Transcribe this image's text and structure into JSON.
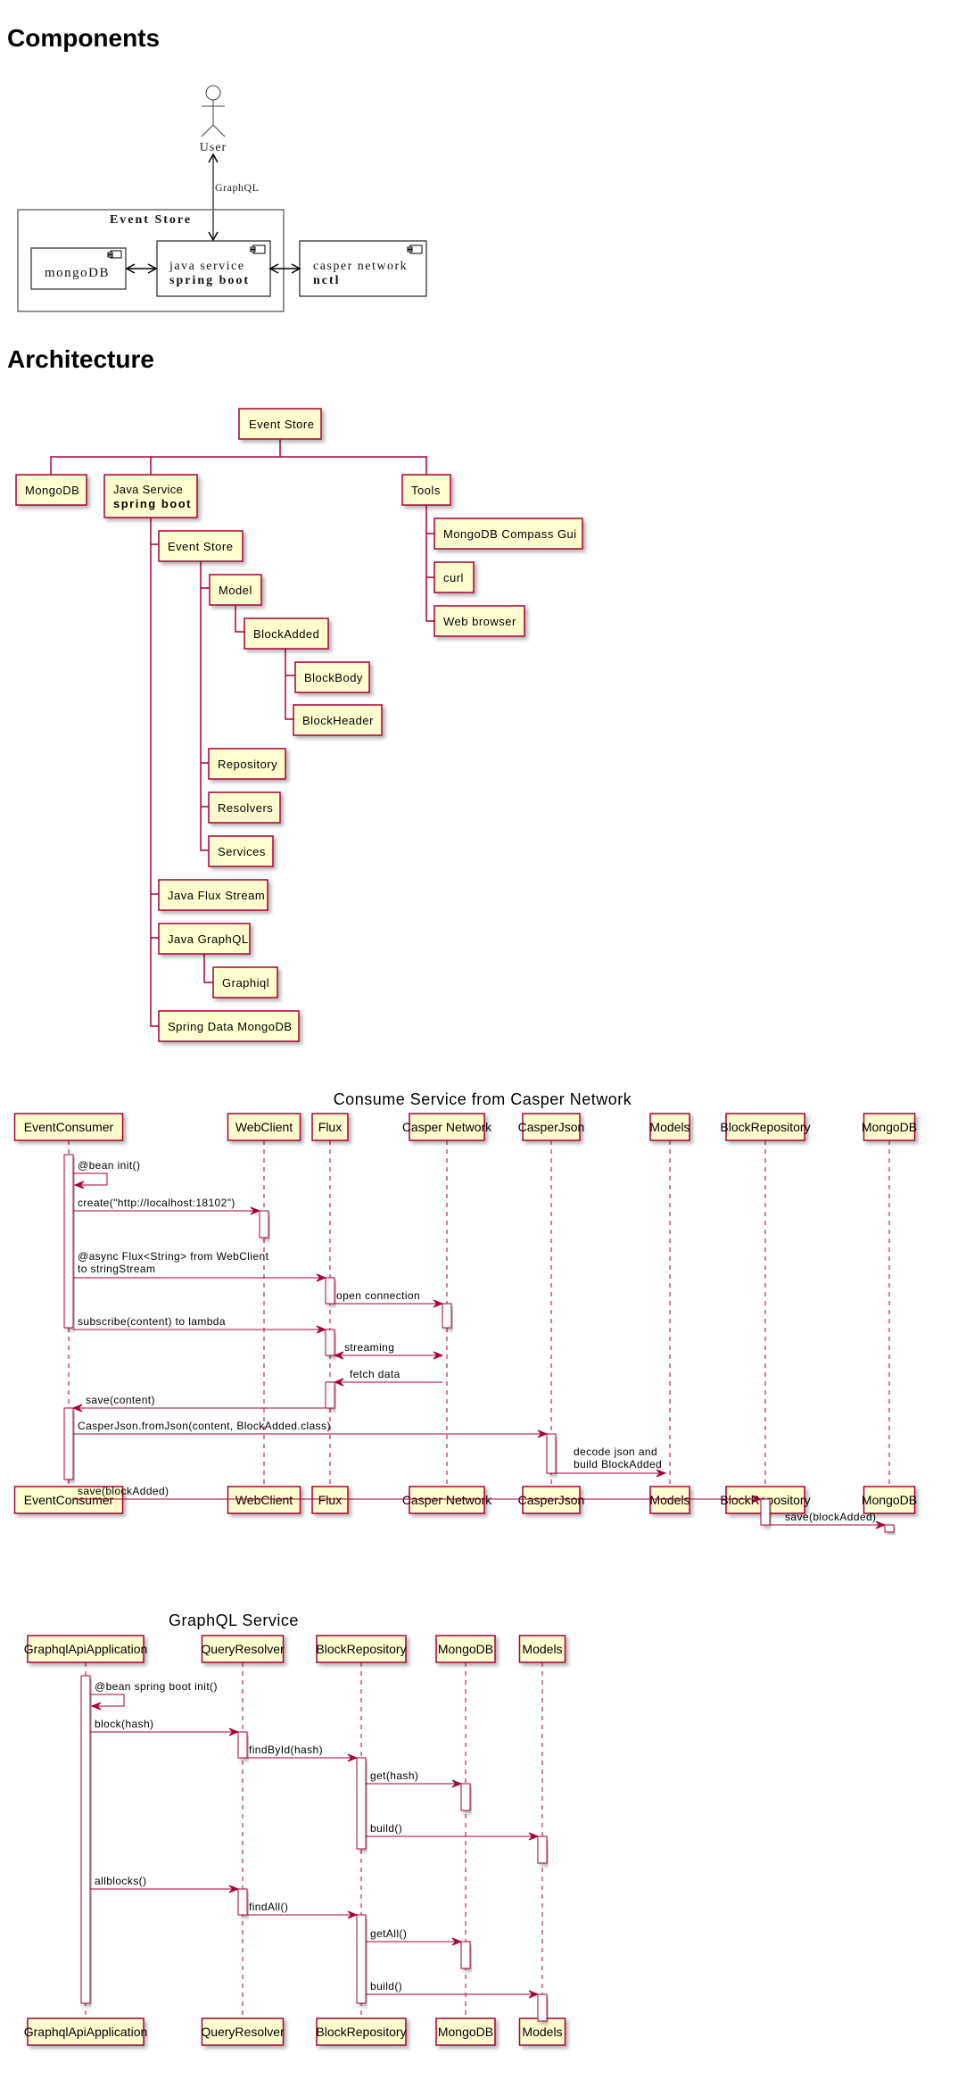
{
  "sections": {
    "components_title": "Components",
    "architecture_title": "Architecture"
  },
  "components": {
    "actor": {
      "label": "User",
      "icon": "actor-stick-figure-icon"
    },
    "link_label": "GraphQL",
    "package": {
      "title": "Event Store"
    },
    "nodes": {
      "mongodb": {
        "label": "mongoDB",
        "icon": "component-icon"
      },
      "java_service": {
        "line1": "java service",
        "line2": "spring boot",
        "icon": "component-icon"
      },
      "casper": {
        "line1": "casper network",
        "line2": "nctl",
        "icon": "component-icon"
      }
    }
  },
  "architecture": {
    "root": "Event Store",
    "mongodb": "MongoDB",
    "java_service": {
      "line1": "Java Service",
      "line2": "spring boot"
    },
    "tools": "Tools",
    "tools_children": [
      "MongoDB Compass Gui",
      "curl",
      "Web browser"
    ],
    "event_store": "Event Store",
    "model": "Model",
    "block_added": "BlockAdded",
    "block_added_children": [
      "BlockBody",
      "BlockHeader"
    ],
    "event_store_children": [
      "Repository",
      "Resolvers",
      "Services"
    ],
    "java_flux_stream": "Java Flux Stream",
    "java_graphql": "Java GraphQL",
    "graphiql": "Graphiql",
    "spring_data": "Spring Data MongoDB"
  },
  "sequence1": {
    "title": "Consume Service from Casper Network",
    "participants": [
      "EventConsumer",
      "WebClient",
      "Flux",
      "Casper Network",
      "CasperJson",
      "Models",
      "BlockRepository",
      "MongoDB"
    ],
    "messages": [
      {
        "from": "EventConsumer",
        "to": "EventConsumer",
        "label": "@bean init()"
      },
      {
        "from": "EventConsumer",
        "to": "WebClient",
        "label": "create(\"http://localhost:18102\")"
      },
      {
        "from": "EventConsumer",
        "to": "Flux",
        "label": "@async Flux<String> from WebClient",
        "label2": "to stringStream"
      },
      {
        "from": "Flux",
        "to": "Casper Network",
        "label": "open connection"
      },
      {
        "from": "EventConsumer",
        "to": "Flux",
        "label": "subscribe(content) to lambda"
      },
      {
        "from": "Flux",
        "to": "Casper Network",
        "label": "streaming",
        "bidirectional": true
      },
      {
        "from": "Casper Network",
        "to": "Flux",
        "label": "fetch data"
      },
      {
        "from": "Flux",
        "to": "EventConsumer",
        "label": "save(content)"
      },
      {
        "from": "EventConsumer",
        "to": "CasperJson",
        "label": "CasperJson.fromJson(content, BlockAdded.class)"
      },
      {
        "from": "CasperJson",
        "to": "Models",
        "label": "decode json and",
        "label2": "build BlockAdded"
      },
      {
        "from": "EventConsumer",
        "to": "BlockRepository",
        "label": "save(blockAdded)"
      },
      {
        "from": "BlockRepository",
        "to": "MongoDB",
        "label": "save(blockAdded)"
      }
    ]
  },
  "sequence2": {
    "title": "GraphQL Service",
    "participants": [
      "GraphqlApiApplication",
      "QueryResolver",
      "BlockRepository",
      "MongoDB",
      "Models"
    ],
    "messages": [
      {
        "from": "GraphqlApiApplication",
        "to": "GraphqlApiApplication",
        "label": "@bean spring boot init()"
      },
      {
        "from": "GraphqlApiApplication",
        "to": "QueryResolver",
        "label": "block(hash)"
      },
      {
        "from": "QueryResolver",
        "to": "BlockRepository",
        "label": "findById(hash)"
      },
      {
        "from": "BlockRepository",
        "to": "MongoDB",
        "label": "get(hash)"
      },
      {
        "from": "BlockRepository",
        "to": "Models",
        "label": "build()"
      },
      {
        "from": "GraphqlApiApplication",
        "to": "QueryResolver",
        "label": "allblocks()"
      },
      {
        "from": "QueryResolver",
        "to": "BlockRepository",
        "label": "findAll()"
      },
      {
        "from": "BlockRepository",
        "to": "MongoDB",
        "label": "getAll()"
      },
      {
        "from": "BlockRepository",
        "to": "Models",
        "label": "build()"
      }
    ]
  },
  "colors": {
    "node_fill": "#fefece",
    "node_border": "#a80036",
    "component_border": "#000000",
    "package_border": "#6e6e6e"
  }
}
